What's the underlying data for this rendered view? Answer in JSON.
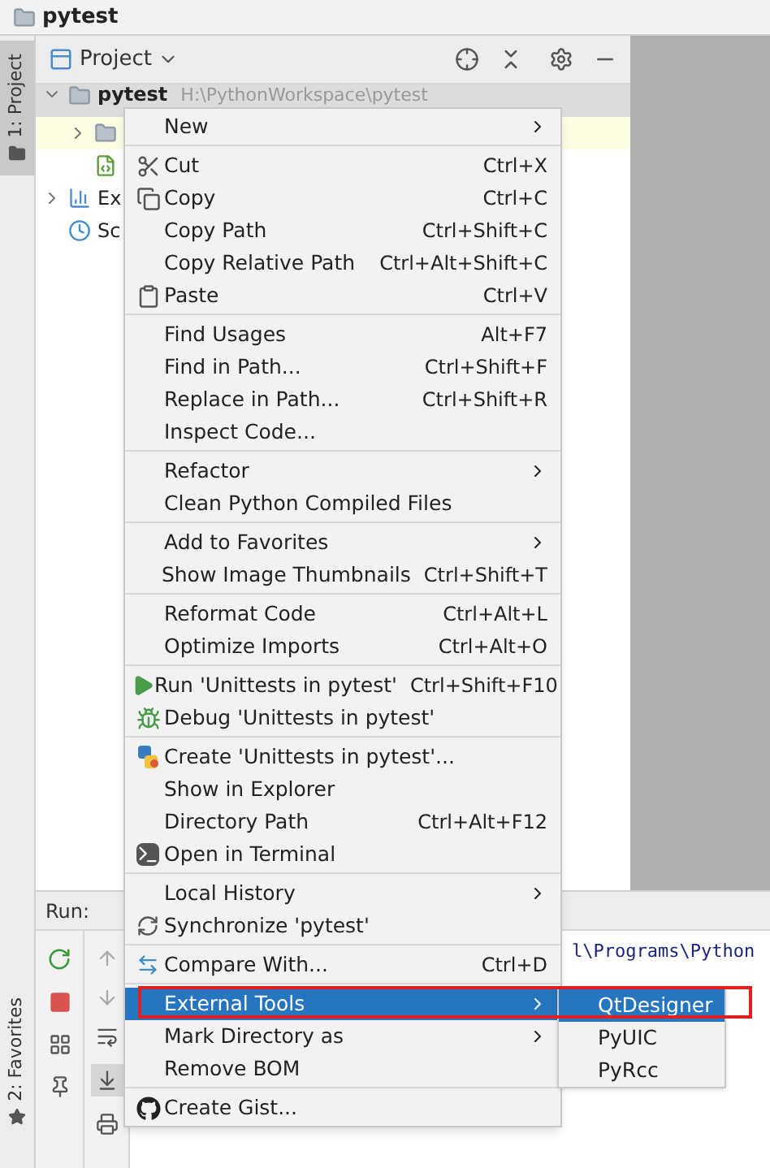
{
  "window": {
    "title": "pytest"
  },
  "tool_stripe": [
    {
      "label": "1: Project",
      "selected": true
    },
    {
      "label": "2: Favorites",
      "selected": false
    }
  ],
  "project_panel": {
    "title": "Project",
    "tree": [
      {
        "label": "pytest",
        "path": "H:\\PythonWorkspace\\pytest",
        "expanded": true,
        "selected": true,
        "highlighted": false,
        "kind": "folder"
      },
      {
        "expanded": false,
        "selected": false,
        "highlighted": true,
        "kind": "folder"
      },
      {
        "selected": false,
        "highlighted": false,
        "kind": "qt-file"
      },
      {
        "label": "Ex",
        "expanded": false,
        "selected": false,
        "highlighted": false,
        "kind": "library"
      },
      {
        "label": "Sc",
        "selected": false,
        "highlighted": false,
        "kind": "scratch"
      }
    ]
  },
  "run_panel": {
    "title": "Run:",
    "console": [
      "l\\Programs\\Python"
    ]
  },
  "menu": {
    "groups": [
      [
        {
          "label": "New",
          "has_submenu": true,
          "selected": false
        }
      ],
      [
        {
          "label": "Cut",
          "shortcut": "Ctrl+X",
          "has_submenu": false,
          "selected": false
        },
        {
          "label": "Copy",
          "shortcut": "Ctrl+C",
          "has_submenu": false,
          "selected": false
        },
        {
          "label": "Copy Path",
          "shortcut": "Ctrl+Shift+C",
          "has_submenu": false,
          "selected": false
        },
        {
          "label": "Copy Relative Path",
          "shortcut": "Ctrl+Alt+Shift+C",
          "has_submenu": false,
          "selected": false
        },
        {
          "label": "Paste",
          "shortcut": "Ctrl+V",
          "has_submenu": false,
          "selected": false
        }
      ],
      [
        {
          "label": "Find Usages",
          "shortcut": "Alt+F7",
          "has_submenu": false,
          "selected": false
        },
        {
          "label": "Find in Path...",
          "shortcut": "Ctrl+Shift+F",
          "has_submenu": false,
          "selected": false
        },
        {
          "label": "Replace in Path...",
          "shortcut": "Ctrl+Shift+R",
          "has_submenu": false,
          "selected": false
        },
        {
          "label": "Inspect Code...",
          "has_submenu": false,
          "selected": false
        }
      ],
      [
        {
          "label": "Refactor",
          "has_submenu": true,
          "selected": false
        },
        {
          "label": "Clean Python Compiled Files",
          "has_submenu": false,
          "selected": false
        }
      ],
      [
        {
          "label": "Add to Favorites",
          "has_submenu": true,
          "selected": false
        },
        {
          "label": "Show Image Thumbnails",
          "shortcut": "Ctrl+Shift+T",
          "has_submenu": false,
          "selected": false
        }
      ],
      [
        {
          "label": "Reformat Code",
          "shortcut": "Ctrl+Alt+L",
          "has_submenu": false,
          "selected": false
        },
        {
          "label": "Optimize Imports",
          "shortcut": "Ctrl+Alt+O",
          "has_submenu": false,
          "selected": false
        }
      ],
      [
        {
          "label": "Run 'Unittests in pytest'",
          "shortcut": "Ctrl+Shift+F10",
          "has_submenu": false,
          "selected": false
        },
        {
          "label": "Debug 'Unittests in pytest'",
          "has_submenu": false,
          "selected": false
        }
      ],
      [
        {
          "label": "Create 'Unittests in pytest'...",
          "has_submenu": false,
          "selected": false
        },
        {
          "label": "Show in Explorer",
          "has_submenu": false,
          "selected": false
        },
        {
          "label": "Directory Path",
          "shortcut": "Ctrl+Alt+F12",
          "has_submenu": false,
          "selected": false
        },
        {
          "label": "Open in Terminal",
          "has_submenu": false,
          "selected": false
        }
      ],
      [
        {
          "label": "Local History",
          "has_submenu": true,
          "selected": false
        },
        {
          "label": "Synchronize 'pytest'",
          "has_submenu": false,
          "selected": false
        }
      ],
      [
        {
          "label": "Compare With...",
          "shortcut": "Ctrl+D",
          "has_submenu": false,
          "selected": false
        }
      ],
      [
        {
          "label": "External Tools",
          "has_submenu": true,
          "selected": true,
          "submenu": [
            {
              "label": "QtDesigner",
              "selected": true
            },
            {
              "label": "PyUIC",
              "selected": false
            },
            {
              "label": "PyRcc",
              "selected": false
            }
          ]
        },
        {
          "label": "Mark Directory as",
          "has_submenu": true,
          "selected": false
        },
        {
          "label": "Remove BOM",
          "has_submenu": false,
          "selected": false
        }
      ],
      [
        {
          "label": "Create Gist...",
          "has_submenu": false,
          "selected": false
        }
      ]
    ]
  }
}
